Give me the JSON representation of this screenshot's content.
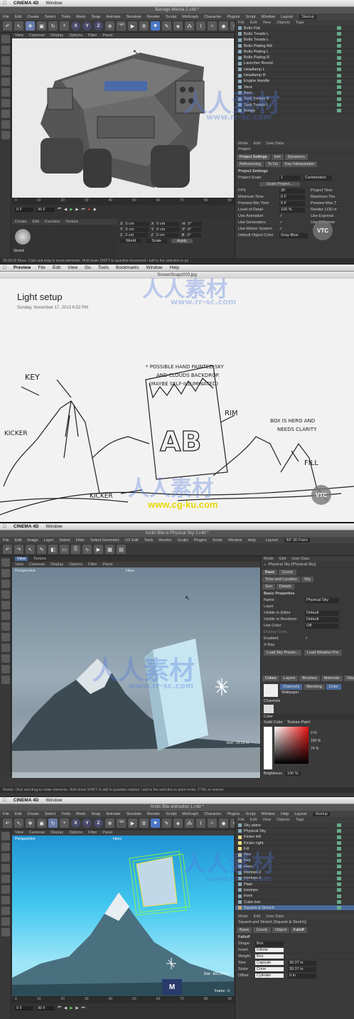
{
  "p1": {
    "mac": {
      "app": "CINEMA 4D",
      "window": "Window"
    },
    "title": "Barrage Mecha 2.c4d *",
    "menu": [
      "File",
      "Edit",
      "Create",
      "Select",
      "Tools",
      "Mesh",
      "Snap",
      "Animate",
      "Simulate",
      "Render",
      "Sculpt",
      "MoGraph",
      "Character",
      "Plugins",
      "Script",
      "Window",
      "Layout:",
      "Startup"
    ],
    "vpmenu": [
      "View",
      "Cameras",
      "Display",
      "Options",
      "Filter",
      "Panel"
    ],
    "objpanel_menu": [
      "File",
      "Edit",
      "View",
      "Objects",
      "Tags"
    ],
    "objects": [
      "Bolts Flat",
      "Bolts Treads L",
      "Bolts Treads L",
      "Bolts Plating Md",
      "Bolts Plating L",
      "Bolts Plating R",
      "Launcher Round",
      "Headlamp L",
      "Headlamp R",
      "Engine Handle",
      "Strut",
      "Axel",
      "Tank Treads R",
      "Tank Treads L",
      "Bridge"
    ],
    "attr_menu": [
      "Mode",
      "Edit",
      "User Data"
    ],
    "attr_title": "Project",
    "attr_tabs": [
      "Project Settings",
      "Info",
      "Dynamics",
      "Referencing",
      "To Do",
      "Key Interpolation"
    ],
    "attr_section": "Project Settings",
    "attr_rows": [
      {
        "l": "Project Scale",
        "v": "1",
        "u": "Centimeters"
      },
      {
        "l": "FPS",
        "v": "30",
        "r": "Project Time"
      },
      {
        "l": "Minimum Time",
        "v": "0 F",
        "r": "Maximum Tim"
      },
      {
        "l": "Preview Min Time",
        "v": "0 F",
        "r": "Preview Max T"
      },
      {
        "l": "Level of Detail",
        "v": "100 %",
        "r": "Render LOD in"
      },
      {
        "l": "Use Animation",
        "v": "✓",
        "r": "Use Expressi"
      },
      {
        "l": "Use Generators",
        "v": "✓",
        "r": "Use Deformer"
      },
      {
        "l": "Use Motion System",
        "v": "✓",
        "r": ""
      },
      {
        "l": "Default Object Color",
        "v": "Gray-Blue",
        "r": ""
      }
    ],
    "scale_btn": "Scale Project...",
    "frame_start": "0 F",
    "frame_end": "90 F",
    "frame_cur": "0 F",
    "ruler": [
      "0",
      "10",
      "20",
      "30",
      "40",
      "50",
      "60",
      "70",
      "80",
      "90"
    ],
    "mat_menu": [
      "Create",
      "Edit",
      "Function",
      "Texture"
    ],
    "material": "Sketch",
    "coord_rows": [
      [
        "X",
        "0 cm",
        "X",
        "0 cm",
        "H",
        "0°"
      ],
      [
        "Y",
        "0 cm",
        "Y",
        "0 cm",
        "P",
        "0°"
      ],
      [
        "Z",
        "0 cm",
        "Z",
        "0 cm",
        "B",
        "0°"
      ]
    ],
    "coord_sel": [
      "World",
      "Scale"
    ],
    "apply": "Apply",
    "status": "00:00:02  Move: Click and drag to move elements. Hold down SHIFT to quantize movement / add to the selection in po"
  },
  "p2": {
    "mac": [
      "Preview",
      "File",
      "Edit",
      "View",
      "Go",
      "Tools",
      "Bookmarks",
      "Window",
      "Help"
    ],
    "title": "ScreenSnapz003.jpg",
    "heading": "Light setup",
    "date": "Sunday, November 17, 2013   6:52 PM",
    "notes": {
      "key": "KEY",
      "kicker1": "KICKER",
      "kicker2": "KICKER",
      "rim": "RIM",
      "fill": "FILL",
      "sky1": "* POSSIBLE HAND PAINTED SKY",
      "sky2": "AND CLOUDS BACKDROP.",
      "sky3": "(MAYBE SELF-ILLUMINATED)",
      "box1": "BOX IS HERO AND",
      "box2": "NEEDS CLARITY",
      "ab": "AB"
    }
  },
  "p3": {
    "mac": {
      "app": "CINEMA 4D",
      "window": "Window"
    },
    "title": "Arctic Bite w Physical Sky 2.c4d *",
    "menu": [
      "File",
      "Edit",
      "Image",
      "Layer",
      "Select",
      "Filter",
      "Select Geometry",
      "UV Edit",
      "Tools",
      "Render",
      "Sculpt",
      "Plugins",
      "Script",
      "Window",
      "Help"
    ],
    "layout": "Layout:",
    "layout_val": "BP 3D Paint",
    "vptabs": [
      "View",
      "Texture"
    ],
    "vpmenu": [
      "View",
      "Cameras",
      "Display",
      "Options",
      "Filter",
      "Panel"
    ],
    "vp_label": "Perspective",
    "vp_cam": "Hero",
    "grid": "Grid : 33.13 m",
    "attr_menu": [
      "Mode",
      "Edit",
      "User Data"
    ],
    "attr_title": "Physical Sky [Physical Sky]",
    "attr_tabs": [
      "Basic",
      "Coord.",
      "Time and Location",
      "Sky",
      "Sun",
      "Details"
    ],
    "attr_section": "Basic Properties",
    "attr_rows": [
      {
        "l": "Name",
        "v": "Physical Sky"
      },
      {
        "l": "Layer",
        "v": ""
      },
      {
        "l": "Visible in Editor",
        "v": "Default"
      },
      {
        "l": "Visible in Renderer",
        "v": "Default"
      },
      {
        "l": "Use Color",
        "v": "Off"
      },
      {
        "l": "Display Color",
        "v": ""
      },
      {
        "l": "Enabled",
        "v": "✓"
      },
      {
        "l": "X-Ray",
        "v": ""
      }
    ],
    "sky_btns": [
      "Load Sky Preset...",
      "Load Weather Pre"
    ],
    "color_tabs": [
      "Colors",
      "Layers",
      "Brushes",
      "Materials",
      "Object"
    ],
    "channel_tabs": [
      "Channels",
      "Blending",
      "Color"
    ],
    "wallpaper": "Wallpaper",
    "channels": "Channels",
    "color_label": "Color",
    "solid": "Solid Color",
    "texpaint": "Texture Paint",
    "pcts": [
      "0 %",
      "100 %",
      "74 %"
    ],
    "brightness": "Brightness",
    "bright_val": "100 %",
    "status": "Rotate: Click and drag to rotate elements. Hold down SHIFT to add to quantize rotation / add to the selection in point mode, CTRL to remove."
  },
  "p4": {
    "mac": {
      "app": "CINEMA 4D",
      "window": "Window"
    },
    "title": "Arctic Bite animation 1.c4d *",
    "menu": [
      "File",
      "Edit",
      "Create",
      "Select",
      "Tools",
      "Mesh",
      "Snap",
      "Animate",
      "Simulate",
      "Render",
      "Sculpt",
      "MoGraph",
      "Character",
      "Plugins",
      "Script",
      "Window",
      "Help",
      "Layout:",
      "Startup"
    ],
    "vpmenu": [
      "View",
      "Cameras",
      "Display",
      "Options",
      "Filter",
      "Panel"
    ],
    "vp_label": "Perspective",
    "vp_cam": "Hero",
    "dist": "Dist : 801.574 in",
    "frame": "Frame : 0",
    "objpanel_menu": [
      "File",
      "Edit",
      "View",
      "Objects",
      "Tags"
    ],
    "objects": [
      "Sky plane",
      "Physical Sky",
      "Kicker left",
      "Kicker right",
      "Fill",
      "Rim",
      "Key",
      "Hero",
      "treetops.2",
      "treetops.1",
      "Plain",
      "treetops",
      "trunk",
      "Cube box",
      "Squash & Stretch"
    ],
    "attr_menu": [
      "Mode",
      "Edit",
      "User Data"
    ],
    "attr_title": "Squash and Stretch [Squash & Stretch]",
    "attr_tabs": [
      "Basic",
      "Coord.",
      "Object",
      "Falloff"
    ],
    "attr_section": "Falloff",
    "attr_rows": [
      {
        "l": "Shape",
        "v": "Box"
      },
      {
        "l": "Invert",
        "v": "Infinite"
      },
      {
        "l": "Weight",
        "v": "Box"
      },
      {
        "l": "Size",
        "v": "Capsule",
        "r": "39.37 in"
      },
      {
        "l": "Scale",
        "v": "Cone",
        "r": "39.37 in"
      },
      {
        "l": "Offset",
        "v": "Cylinder",
        "r": "0 in"
      }
    ],
    "frame_start": "0 F",
    "frame_end": "90 F",
    "ruler": [
      "0",
      "10",
      "20",
      "30",
      "40",
      "50",
      "60",
      "70",
      "80",
      "90"
    ]
  },
  "watermarks": {
    "cn": "人人素材",
    "url1": "www.rr-sc.com",
    "url2": "www.cg-ku.com",
    "vtc": "VTC"
  },
  "colors": {
    "c4d_bg": "#3b3b3b",
    "accent": "#4a6a9a",
    "sketch_bg": "#f2f2f2",
    "sky": "#41c7f0"
  }
}
